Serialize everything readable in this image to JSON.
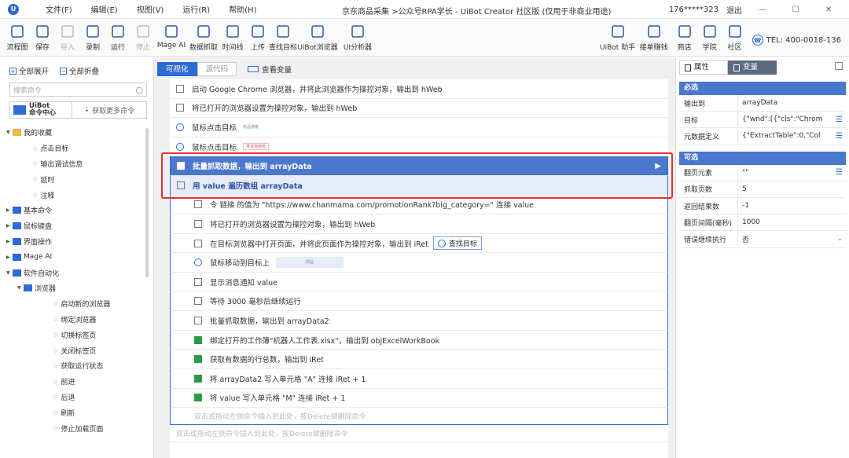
{
  "titlebar": {
    "menu": [
      "文件(F)",
      "编辑(E)",
      "视图(V)",
      "运行(R)",
      "帮助(H)"
    ],
    "title": "京东商品采集 >公众号RPA学长 - UiBot Creator 社区版 (仅用于非商业用途)",
    "user": "176*****323",
    "logout": "退出"
  },
  "toolbar": {
    "left": [
      "流程图",
      "保存",
      "导入",
      "录制",
      "运行",
      "停止",
      "Mage AI",
      "数据抓取",
      "时间线",
      "上传",
      "查找目标",
      "UiBot浏览器",
      "UI分析器"
    ],
    "right": [
      "UiBot 助手",
      "接单赚钱",
      "商店",
      "学院",
      "社区"
    ],
    "tel": "TEL: 400-0018-136"
  },
  "left": {
    "expand": "全部展开",
    "collapse": "全部折叠",
    "search_placeholder": "搜索命令",
    "center_a": "UiBot",
    "center_b": "命令中心",
    "get_more": "获取更多命令",
    "tree": [
      {
        "label": "我的收藏",
        "level": 0,
        "type": "folder",
        "open": true
      },
      {
        "label": "点击目标",
        "level": 1
      },
      {
        "label": "输出调试信息",
        "level": 1
      },
      {
        "label": "延时",
        "level": 1
      },
      {
        "label": "注释",
        "level": 1
      },
      {
        "label": "基本命令",
        "level": 0,
        "type": "cat"
      },
      {
        "label": "鼠标键盘",
        "level": 0,
        "type": "cat"
      },
      {
        "label": "界面操作",
        "level": 0,
        "type": "cat"
      },
      {
        "label": "Mage AI",
        "level": 0,
        "type": "cat"
      },
      {
        "label": "软件自动化",
        "level": 0,
        "type": "cat",
        "open": true
      },
      {
        "label": "浏览器",
        "level": 1,
        "type": "cat",
        "open": true
      },
      {
        "label": "启动新的浏览器",
        "level": 2
      },
      {
        "label": "绑定浏览器",
        "level": 2
      },
      {
        "label": "切换标签页",
        "level": 2
      },
      {
        "label": "关闭标签页",
        "level": 2
      },
      {
        "label": "获取运行状态",
        "level": 2
      },
      {
        "label": "前进",
        "level": 2
      },
      {
        "label": "后退",
        "level": 2
      },
      {
        "label": "刷新",
        "level": 2
      },
      {
        "label": "停止加载页面",
        "level": 2
      }
    ]
  },
  "center": {
    "tab_visual": "可视化",
    "tab_source": "源代码",
    "view_vars": "查看变量",
    "rows": [
      {
        "text": "启动 Google Chrome 浏览器，并将此浏览器作为操控对象，输出到 hWeb",
        "icon": "box"
      },
      {
        "text": "将已打开的浏览器设置为操控对象，输出到 hWeb",
        "icon": "box"
      },
      {
        "text": "鼠标点击目标",
        "icon": "circle",
        "chip": "商品搜索"
      },
      {
        "text": "鼠标点击目标",
        "icon": "circle",
        "chip": "带货视频榜",
        "chipRed": true
      },
      {
        "text": "批量抓取数据，输出到 arrayData",
        "icon": "box",
        "cls": "hl"
      },
      {
        "text": "用 value 遍历数组 arrayData",
        "icon": "box",
        "cls": "loop"
      },
      {
        "text": "令 链接 的值为 \"https://www.chanmama.com/promotionRank?big_category=\" 连接 value",
        "icon": "box",
        "child": true
      },
      {
        "text": "将已打开的浏览器设置为操控对象，输出到 hWeb",
        "icon": "box",
        "child": true
      },
      {
        "text": "在目标浏览器中打开页面，并将此页面作为操控对象，输出到 iRet",
        "icon": "box",
        "child": true,
        "find": "查找目标"
      },
      {
        "text": "鼠标移动到目标上",
        "icon": "circle",
        "child": true,
        "chipBox": "商品"
      },
      {
        "text": "显示消息通知 value",
        "icon": "box",
        "child": true
      },
      {
        "text": "等待 3000 毫秒后继续运行",
        "icon": "box",
        "child": true
      },
      {
        "text": "批量抓取数据，输出到 arrayData2",
        "icon": "box",
        "child": true
      },
      {
        "text": "绑定打开的工作簿\"机器人工作表.xlsx\"，输出到 objExcelWorkBook",
        "icon": "green",
        "child": true
      },
      {
        "text": "获取有数据的行总数，输出到 iRet",
        "icon": "green",
        "child": true
      },
      {
        "text": "将 arrayData2 写入单元格 \"A\" 连接 iRet + 1",
        "icon": "green",
        "child": true
      },
      {
        "text": "将 value 写入单元格 \"M\" 连接 iRet + 1",
        "icon": "green",
        "child": true
      }
    ],
    "inner_placeholder": "双击或拖动左侧命令插入到此处，按Delete键删除命令",
    "outer_placeholder": "双击或拖动左侧命令插入到此处，按Delete键删除命令"
  },
  "right": {
    "tab_props": "属性",
    "tab_vars": "变量",
    "required": "必选",
    "optional": "可选",
    "req": [
      {
        "k": "输出到",
        "v": "arrayData"
      },
      {
        "k": "目标",
        "v": "{\"wnd\":[{\"cls\":\"Chrom",
        "list": true
      },
      {
        "k": "元数据定义",
        "v": "{\"ExtractTable\":0,\"Col",
        "list": true
      }
    ],
    "opt": [
      {
        "k": "翻页元素",
        "v": "\"\"",
        "list": true
      },
      {
        "k": "抓取页数",
        "v": "5"
      },
      {
        "k": "返回结果数",
        "v": "-1"
      },
      {
        "k": "翻页间隔(毫秒)",
        "v": "1000"
      },
      {
        "k": "错误继续执行",
        "v": "否",
        "drop": true
      }
    ]
  }
}
